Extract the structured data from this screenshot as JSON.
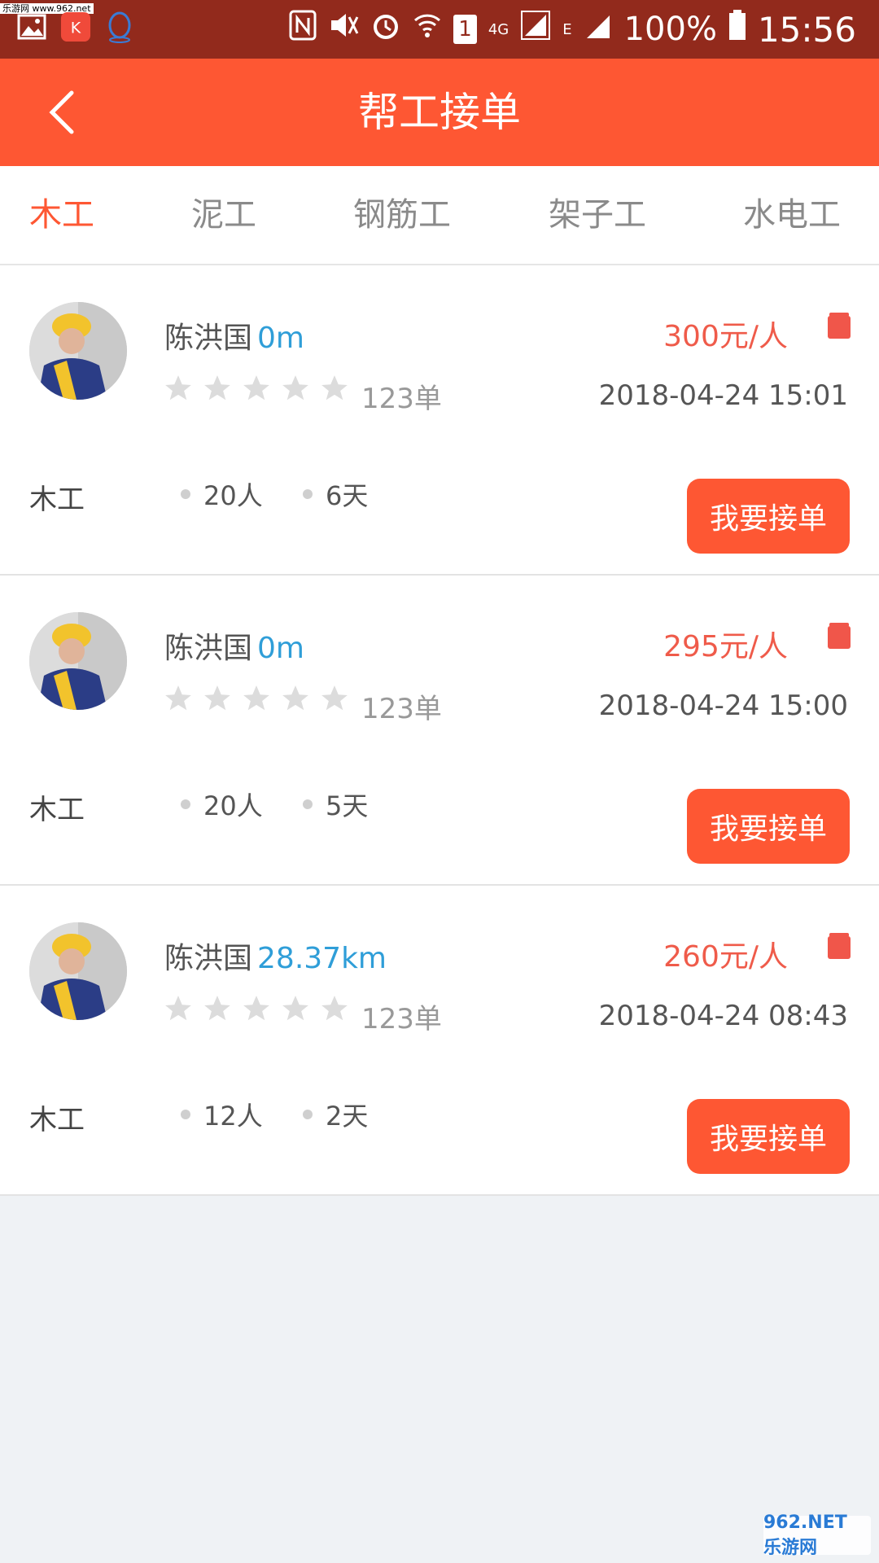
{
  "status_bar": {
    "watermark": "乐游网 www.962.net",
    "network_4g": "4G",
    "network_e": "E",
    "sim": "1",
    "battery": "100%",
    "time": "15:56"
  },
  "header": {
    "title": "帮工接单",
    "back_icon": "chevron-left-icon"
  },
  "tabs": [
    {
      "label": "木工",
      "active": true
    },
    {
      "label": "泥工",
      "active": false
    },
    {
      "label": "钢筋工",
      "active": false
    },
    {
      "label": "架子工",
      "active": false
    },
    {
      "label": "水电工",
      "active": false
    }
  ],
  "orders": [
    {
      "name": "陈洪国",
      "distance": "0m",
      "rating": 0,
      "order_count": "123单",
      "price": "300元/人",
      "datetime": "2018-04-24 15:01",
      "trade": "木工",
      "people": "20人",
      "days": "6天",
      "action": "我要接单"
    },
    {
      "name": "陈洪国",
      "distance": "0m",
      "rating": 0,
      "order_count": "123单",
      "price": "295元/人",
      "datetime": "2018-04-24 15:00",
      "trade": "木工",
      "people": "20人",
      "days": "5天",
      "action": "我要接单"
    },
    {
      "name": "陈洪国",
      "distance": "28.37km",
      "rating": 0,
      "order_count": "123单",
      "price": "260元/人",
      "datetime": "2018-04-24 08:43",
      "trade": "木工",
      "people": "12人",
      "days": "2天",
      "action": "我要接单"
    }
  ],
  "bottom_watermark": "962.NET 乐游网",
  "colors": {
    "status_bar": "#922a1c",
    "accent": "#fe5733",
    "price": "#ef5b4a",
    "distance": "#2f9ed8",
    "background": "#eff2f5"
  }
}
